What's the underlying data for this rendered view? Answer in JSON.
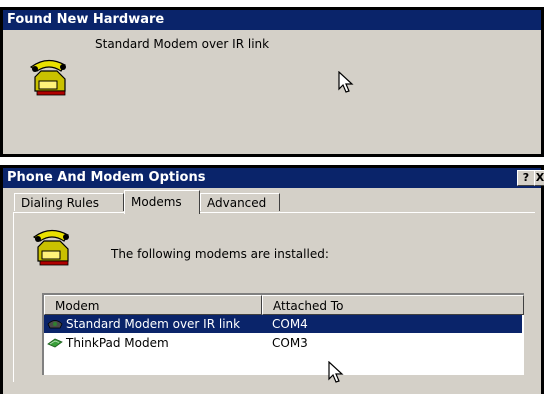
{
  "found_window": {
    "title": "Found New Hardware",
    "device_name": "Standard Modem over IR link"
  },
  "options_window": {
    "title": "Phone And Modem Options",
    "help_label": "?",
    "close_label": "X",
    "tabs": [
      {
        "label": "Dialing Rules",
        "active": false
      },
      {
        "label": "Modems",
        "active": true
      },
      {
        "label": "Advanced",
        "active": false
      }
    ],
    "installed_text": "The following modems are  installed:",
    "list": {
      "columns": [
        "Modem",
        "Attached To"
      ],
      "rows": [
        {
          "modem": "Standard Modem over IR link",
          "port": "COM4",
          "selected": true,
          "icon": "ir-modem-icon"
        },
        {
          "modem": "ThinkPad Modem",
          "port": "COM3",
          "selected": false,
          "icon": "modem-card-icon"
        }
      ]
    }
  },
  "colors": {
    "title_bar": "#0a246a",
    "dialog_face": "#d4d0c8",
    "selection": "#0a246a"
  }
}
